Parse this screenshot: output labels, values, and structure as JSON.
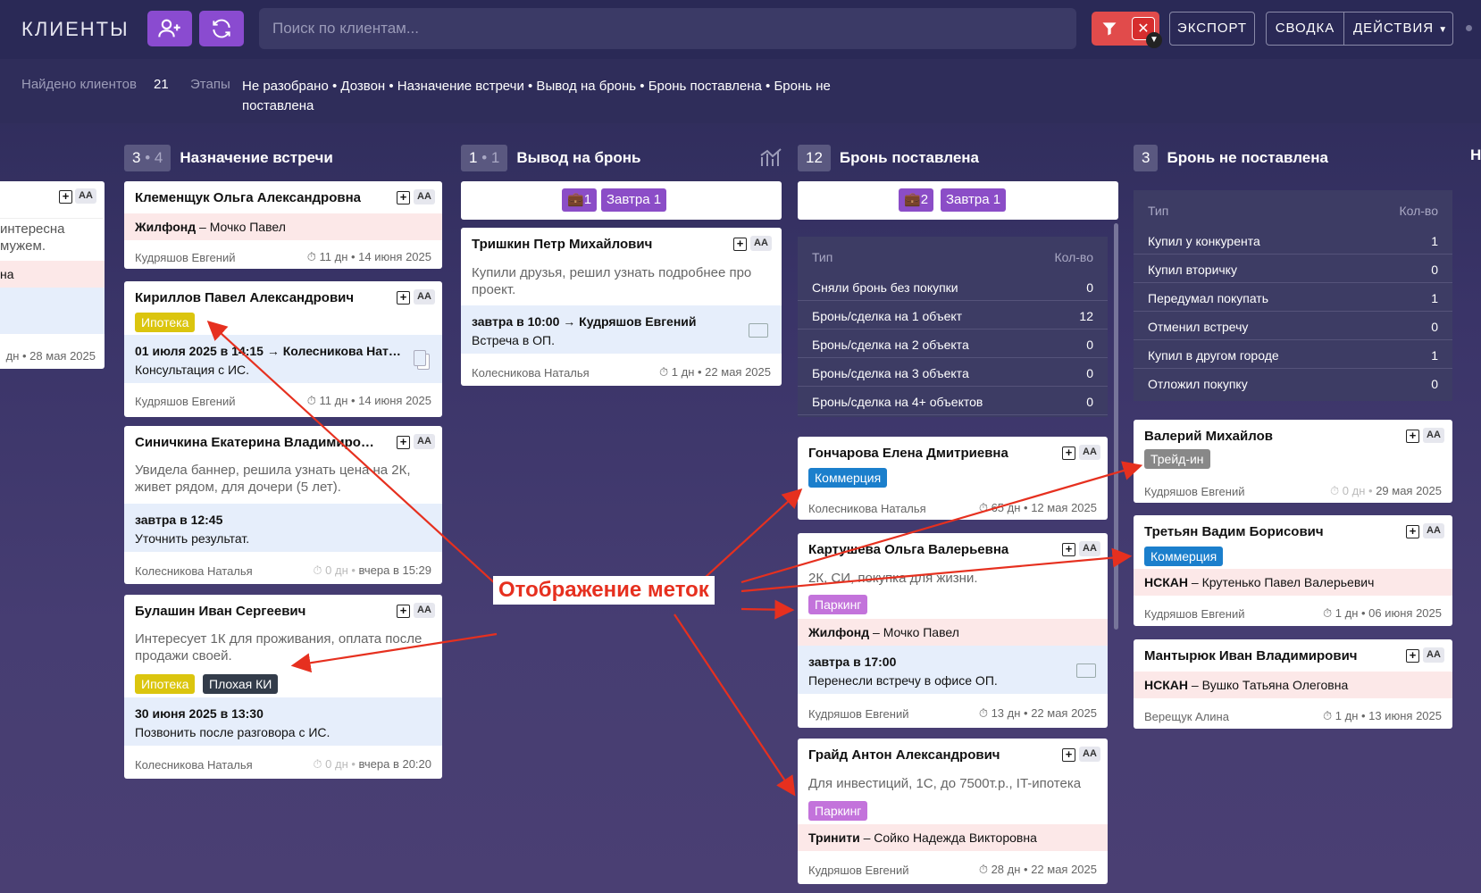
{
  "header": {
    "title": "КЛИЕНТЫ",
    "add_user_icon": "add-user-icon",
    "refresh_icon": "refresh-icon",
    "search_placeholder": "Поиск по клиентам...",
    "filter_icon": "filter-icon",
    "clear_filter_label": "✕",
    "export_label": "ЭКСПОРТ",
    "summary_label": "СВОДКА",
    "actions_label": "ДЕЙСТВИЯ",
    "accent": "#8a4bd0",
    "filter_color": "#e14b4b"
  },
  "info": {
    "found_label": "Найдено клиентов",
    "found_count": "21",
    "stages_label": "Этапы",
    "stages_value": "Не разобрано • Дозвон • Назначение встречи • Вывод на бронь • Бронь поставлена • Бронь не поставлена"
  },
  "partial_left_card": {
    "desc": "интересна\nмужем.",
    "pink": "на",
    "footer_right": "дн • 28 мая 2025"
  },
  "columns": {
    "meeting": {
      "count": "3",
      "count_sub": "4",
      "title": "Назначение встречи",
      "cards": [
        {
          "name": "Клеменщук Ольга Александровна",
          "pink_bold": "Жилфонд",
          "pink_rest": " – Мочко Павел",
          "manager": "Кудряшов Евгений",
          "meta": "11 дн • 14 июня 2025"
        },
        {
          "name": "Кириллов Павел Александрович",
          "tag": "Ипотека",
          "blue_title": "01 июля 2025 в 14:15 → Колесникова Нат…",
          "blue_text": "Консультация с ИС.",
          "manager": "Кудряшов Евгений",
          "meta": "11 дн • 14 июня 2025"
        },
        {
          "name": "Синичкина Екатерина Владимиро…",
          "desc": "Увидела баннер, решила узнать цена на 2К, живет рядом, для дочери (5 лет).",
          "blue_title": "завтра в 12:45",
          "blue_text": "Уточнить результат.",
          "manager": "Колесникова Наталья",
          "meta_a": "0 дн •",
          "meta_b": "вчера в 15:29"
        },
        {
          "name": "Булашин Иван Сергеевич",
          "desc": "Интересует 1К для проживания, оплата после продажи своей.",
          "tag1": "Ипотека",
          "tag2": "Плохая КИ",
          "blue_title": "30 июня 2025 в 13:30",
          "blue_text": "Позвонить после разговора с ИС.",
          "manager": "Колесникова Наталья",
          "meta_a": "0 дн •",
          "meta_b": "вчера в 20:20"
        }
      ]
    },
    "booking_out": {
      "count": "1",
      "count_sub": "1",
      "title": "Вывод на бронь",
      "pill_count": "1",
      "pill_tomorrow": "Завтра",
      "pill_tomorrow_count": "1",
      "cards": [
        {
          "name": "Тришкин Петр Михайлович",
          "desc": "Купили друзья, решил узнать подробнее про проект.",
          "blue_title": "завтра в 10:00 → Кудряшов Евгений",
          "blue_text": "Встреча в ОП.",
          "manager": "Колесникова Наталья",
          "meta": "1 дн • 22 мая 2025"
        }
      ]
    },
    "booked": {
      "count": "12",
      "title": "Бронь поставлена",
      "pill_count": "2",
      "pill_tomorrow": "Завтра",
      "pill_tomorrow_count": "1",
      "table_head": {
        "k": "Тип",
        "v": "Кол-во"
      },
      "table": [
        {
          "k": "Сняли бронь без покупки",
          "v": "0"
        },
        {
          "k": "Бронь/сделка на 1 объект",
          "v": "12"
        },
        {
          "k": "Бронь/сделка на 2 объекта",
          "v": "0"
        },
        {
          "k": "Бронь/сделка на 3 объекта",
          "v": "0"
        },
        {
          "k": "Бронь/сделка на 4+ объектов",
          "v": "0"
        }
      ],
      "cards": [
        {
          "name": "Гончарова Елена Дмитриевна",
          "tag": "Коммерция",
          "manager": "Колесникова Наталья",
          "meta": "65 дн • 12 мая 2025"
        },
        {
          "name": "Картушева Ольга Валерьевна",
          "desc": "2К, СИ, покупка для жизни.",
          "tag": "Паркинг",
          "pink_bold": "Жилфонд",
          "pink_rest": " – Мочко Павел",
          "blue_title": "завтра в 17:00",
          "blue_text": "Перенесли встречу в офисе ОП.",
          "manager": "Кудряшов Евгений",
          "meta": "13 дн • 22 мая 2025"
        },
        {
          "name": "Грайд Антон Александрович",
          "desc": "Для инвестиций, 1С, до 7500т.р., IT-ипотека",
          "tag": "Паркинг",
          "pink_bold": "Тринити",
          "pink_rest": " – Сойко Надежда Викторовна",
          "manager": "Кудряшов Евгений",
          "meta": "28 дн • 22 мая 2025"
        }
      ]
    },
    "not_booked": {
      "count": "3",
      "title": "Бронь не поставлена",
      "table_head": {
        "k": "Тип",
        "v": "Кол-во"
      },
      "table": [
        {
          "k": "Купил у конкурента",
          "v": "1"
        },
        {
          "k": "Купил вторичку",
          "v": "0"
        },
        {
          "k": "Передумал покупать",
          "v": "1"
        },
        {
          "k": "Отменил встречу",
          "v": "0"
        },
        {
          "k": "Купил в другом городе",
          "v": "1"
        },
        {
          "k": "Отложил покупку",
          "v": "0"
        }
      ],
      "cards": [
        {
          "name": "Валерий Михайлов",
          "tag": "Трейд-ин",
          "manager": "Кудряшов Евгений",
          "meta_a": "0 дн •",
          "meta_b": "29 мая 2025"
        },
        {
          "name": "Третьян Вадим Борисович",
          "tag": "Коммерция",
          "pink_bold": "НСКАН",
          "pink_rest": " – Крутенько Павел Валерьевич",
          "manager": "Кудряшов Евгений",
          "meta": "1 дн • 06 июня 2025"
        },
        {
          "name": "Мантырюк Иван Владимирович",
          "pink_bold": "НСКАН",
          "pink_rest": " – Вушко Татьяна Олеговна",
          "manager": "Верещук Алина",
          "meta": "1 дн • 13 июня 2025"
        }
      ]
    },
    "next_col_initial": "Н"
  },
  "common": {
    "aa_label": "AA",
    "plus_label": "+",
    "timer_icon": "⏱"
  },
  "annotation": {
    "text": "Отображение меток",
    "color": "#e6301f"
  }
}
